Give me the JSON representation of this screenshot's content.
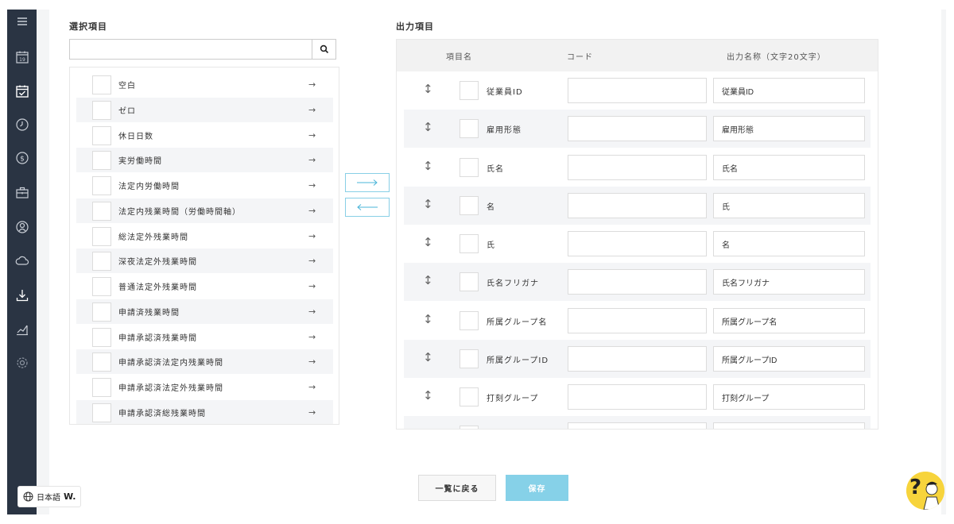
{
  "sidebar": {
    "icons": [
      "menu-icon",
      "calendar-icon",
      "calendar-check-icon",
      "clock-icon",
      "dollar-icon",
      "briefcase-icon",
      "person-icon",
      "cloud-icon",
      "download-icon",
      "chart-icon",
      "gear-icon"
    ]
  },
  "selection": {
    "title": "選択項目",
    "search_placeholder": "",
    "items": [
      "空白",
      "ゼロ",
      "休日日数",
      "実労働時間",
      "法定内労働時間",
      "法定内残業時間（労働時間軸）",
      "総法定外残業時間",
      "深夜法定外残業時間",
      "普通法定外残業時間",
      "申請済残業時間",
      "申請承認済残業時間",
      "申請承認済法定内残業時間",
      "申請承認済法定外残業時間",
      "申請承認済総残業時間"
    ],
    "arrow": "→"
  },
  "transfer": {
    "add": "⟶",
    "remove": "⟵"
  },
  "output": {
    "title": "出力項目",
    "headers": {
      "name": "項目名",
      "code": "コード",
      "display": "出力名称（文字20文字）"
    },
    "rows": [
      {
        "name": "従業員ID",
        "code": "",
        "display": "従業員ID"
      },
      {
        "name": "雇用形態",
        "code": "",
        "display": "雇用形態"
      },
      {
        "name": "氏名",
        "code": "",
        "display": "氏名"
      },
      {
        "name": "名",
        "code": "",
        "display": "氏"
      },
      {
        "name": "氏",
        "code": "",
        "display": "名"
      },
      {
        "name": "氏名フリガナ",
        "code": "",
        "display": "氏名フリガナ"
      },
      {
        "name": "所属グループ名",
        "code": "",
        "display": "所属グループ名"
      },
      {
        "name": "所属グループID",
        "code": "",
        "display": "所属グループID"
      },
      {
        "name": "打刻グループ",
        "code": "",
        "display": "打刻グループ"
      },
      {
        "name": "",
        "code": "",
        "display": ""
      }
    ],
    "drag_glyph": "↕"
  },
  "actions": {
    "back": "一覧に戻る",
    "save": "保存"
  },
  "language": {
    "label": "日本語",
    "brand": "W."
  },
  "help": {
    "glyph": "?"
  },
  "colors": {
    "sidebar": "#2a3443",
    "accent": "#86d1e8",
    "alt_row": "#f4f5f7"
  }
}
